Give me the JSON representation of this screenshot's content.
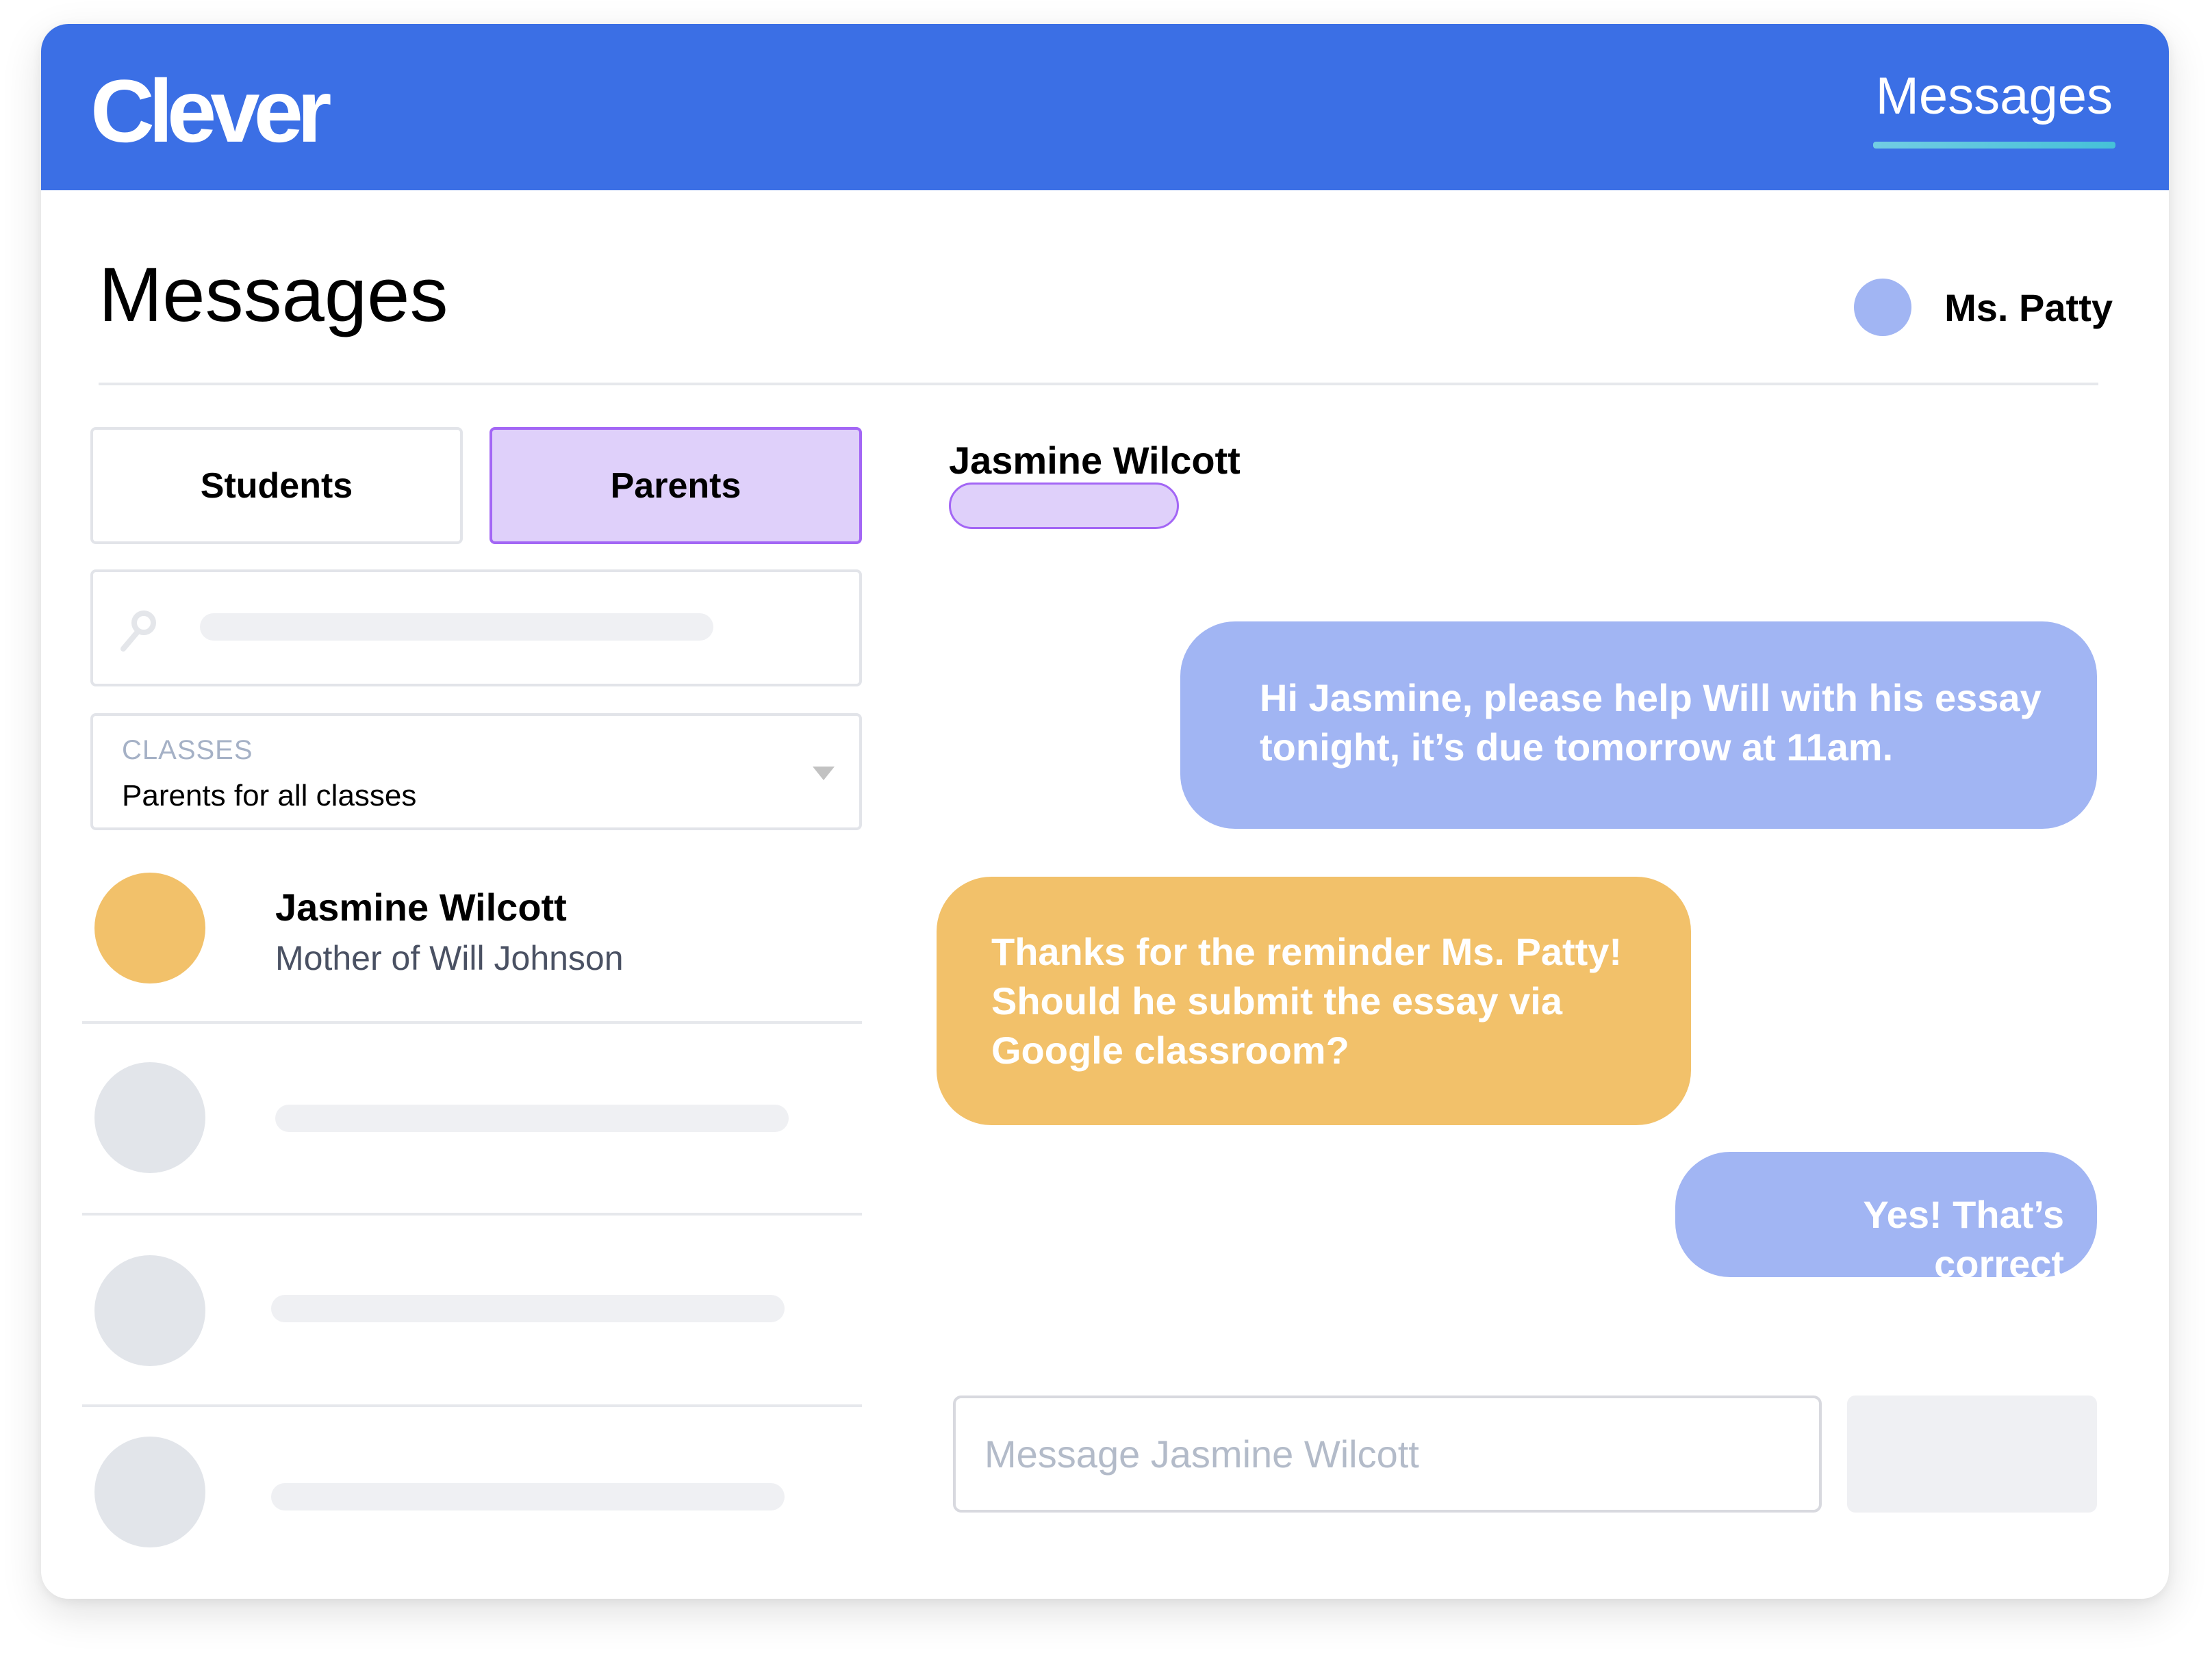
{
  "app": {
    "logo": "Clever",
    "nav": {
      "active_tab": "Messages"
    }
  },
  "page": {
    "title": "Messages",
    "current_user": {
      "name": "Ms. Patty",
      "avatar_color": "#a1b5f3"
    }
  },
  "sidebar": {
    "tabs": [
      {
        "label": "Students",
        "selected": false
      },
      {
        "label": "Parents",
        "selected": true
      }
    ],
    "search": {
      "icon": "search-icon",
      "value": ""
    },
    "classes_filter": {
      "label": "CLASSES",
      "selected": "Parents for all classes"
    },
    "contacts": [
      {
        "name": "Jasmine Wilcott",
        "subtitle": "Mother of Will Johnson",
        "avatar_color": "#f2c16a"
      },
      {
        "name": "",
        "subtitle": "",
        "avatar_color": "#e2e5ea"
      },
      {
        "name": "",
        "subtitle": "",
        "avatar_color": "#e2e5ea"
      },
      {
        "name": "",
        "subtitle": "",
        "avatar_color": "#e2e5ea"
      }
    ]
  },
  "conversation": {
    "contact_name": "Jasmine Wilcott",
    "messages": [
      {
        "sender": "teacher",
        "text": "Hi Jasmine, please help Will with his essay tonight, it’s due tomorrow at 11am.",
        "color": "#a1b5f3"
      },
      {
        "sender": "parent",
        "text": "Thanks for the reminder Ms. Patty! Should he submit the essay via Google classroom?",
        "color": "#f2c16a"
      },
      {
        "sender": "teacher",
        "text": "Yes! That’s correct",
        "color": "#a1b5f3"
      }
    ],
    "composer": {
      "placeholder": "Message Jasmine Wilcott",
      "value": ""
    },
    "send_label": ""
  },
  "colors": {
    "brand_blue": "#3b6fe5",
    "accent_purple": "#a366f5",
    "selected_fill": "#dfd0fa",
    "underline_teal": "#45c1d8"
  }
}
